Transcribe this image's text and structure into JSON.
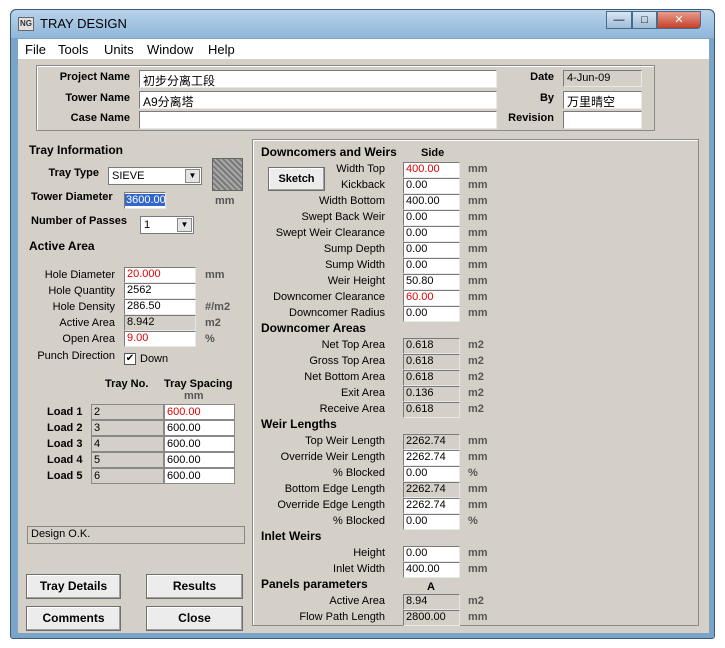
{
  "window": {
    "title": "TRAY DESIGN",
    "app_icon": "NG",
    "min": "0",
    "max": "1",
    "close": "r"
  },
  "menu": [
    "File",
    "Tools",
    "Units",
    "Window",
    "Help"
  ],
  "header": {
    "project_name_label": "Project Name",
    "project_name": "初步分离工段",
    "tower_name_label": "Tower Name",
    "tower_name": "A9分离塔",
    "case_name_label": "Case Name",
    "case_name": "",
    "date_label": "Date",
    "date": "4-Jun-09",
    "by_label": "By",
    "by": "万里晴空",
    "revision_label": "Revision",
    "revision": ""
  },
  "tray_info": {
    "title": "Tray Information",
    "tray_type_label": "Tray Type",
    "tray_type": "SIEVE",
    "diameter_label": "Tower Diameter",
    "diameter": "3600.00",
    "diameter_unit": "mm",
    "passes_label": "Number of Passes",
    "passes": "1"
  },
  "active_area": {
    "title": "Active Area",
    "rows": [
      {
        "label": "Hole Diameter",
        "value": "20.000",
        "unit": "mm"
      },
      {
        "label": "Hole Quantity",
        "value": "2562",
        "unit": ""
      },
      {
        "label": "Hole Density",
        "value": "286.50",
        "unit": "#/m2"
      },
      {
        "label": "Active Area",
        "value": "8.942",
        "unit": "m2"
      },
      {
        "label": "Open Area",
        "value": "9.00",
        "unit": "%"
      }
    ],
    "punch_label": "Punch Direction",
    "punch_value": "Down",
    "punch_check": "✔"
  },
  "loads": {
    "col_tray": "Tray No.",
    "col_spacing": "Tray Spacing",
    "spacing_unit": "mm",
    "rows": [
      {
        "label": "Load 1",
        "tray": "2",
        "spacing": "600.00"
      },
      {
        "label": "Load 2",
        "tray": "3",
        "spacing": "600.00"
      },
      {
        "label": "Load 3",
        "tray": "4",
        "spacing": "600.00"
      },
      {
        "label": "Load 4",
        "tray": "5",
        "spacing": "600.00"
      },
      {
        "label": "Load 5",
        "tray": "6",
        "spacing": "600.00"
      }
    ]
  },
  "status": "Design O.K.",
  "buttons": {
    "tray_details": "Tray Details",
    "results": "Results",
    "comments": "Comments",
    "close": "Close",
    "sketch": "Sketch"
  },
  "downcomers": {
    "title": "Downcomers and Weirs",
    "side": "Side",
    "rows": [
      {
        "label": "Width Top",
        "value": "400.00",
        "unit": "mm"
      },
      {
        "label": "Kickback",
        "value": "0.00",
        "unit": "mm"
      },
      {
        "label": "Width Bottom",
        "value": "400.00",
        "unit": "mm"
      },
      {
        "label": "Swept Back Weir",
        "value": "0.00",
        "unit": "mm"
      },
      {
        "label": "Swept Weir Clearance",
        "value": "0.00",
        "unit": "mm"
      },
      {
        "label": "Sump Depth",
        "value": "0.00",
        "unit": "mm"
      },
      {
        "label": "Sump Width",
        "value": "0.00",
        "unit": "mm"
      },
      {
        "label": "Weir Height",
        "value": "50.80",
        "unit": "mm"
      },
      {
        "label": "Downcomer Clearance",
        "value": "60.00",
        "unit": "mm"
      },
      {
        "label": "Downcomer Radius",
        "value": "0.00",
        "unit": "mm"
      }
    ]
  },
  "dc_areas": {
    "title": "Downcomer Areas",
    "rows": [
      {
        "label": "Net Top Area",
        "value": "0.618",
        "unit": "m2"
      },
      {
        "label": "Gross Top Area",
        "value": "0.618",
        "unit": "m2"
      },
      {
        "label": "Net Bottom Area",
        "value": "0.618",
        "unit": "m2"
      },
      {
        "label": "Exit Area",
        "value": "0.136",
        "unit": "m2"
      },
      {
        "label": "Receive Area",
        "value": "0.618",
        "unit": "m2"
      }
    ]
  },
  "weir_lengths": {
    "title": "Weir Lengths",
    "rows": [
      {
        "label": "Top Weir Length",
        "value": "2262.74",
        "unit": "mm"
      },
      {
        "label": "Override Weir Length",
        "value": "2262.74",
        "unit": "mm"
      },
      {
        "label": "% Blocked",
        "value": "0.00",
        "unit": "%"
      },
      {
        "label": "Bottom Edge Length",
        "value": "2262.74",
        "unit": "mm"
      },
      {
        "label": "Override Edge Length",
        "value": "2262.74",
        "unit": "mm"
      },
      {
        "label": "% Blocked",
        "value": "0.00",
        "unit": "%"
      }
    ]
  },
  "inlet_weirs": {
    "title": "Inlet Weirs",
    "rows": [
      {
        "label": "Height",
        "value": "0.00",
        "unit": "mm"
      },
      {
        "label": "Inlet Width",
        "value": "400.00",
        "unit": "mm"
      }
    ]
  },
  "panels": {
    "title": "Panels parameters",
    "col": "A",
    "rows": [
      {
        "label": "Active Area",
        "value": "8.94",
        "unit": "m2"
      },
      {
        "label": "Flow Path Length",
        "value": "2800.00",
        "unit": "mm"
      }
    ]
  }
}
